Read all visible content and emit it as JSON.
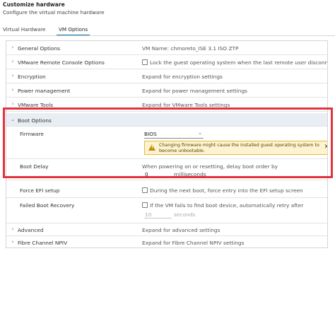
{
  "header": {
    "title": "Customize hardware",
    "subtitle": "Configure the virtual machine hardware"
  },
  "tabs": [
    {
      "label": "Virtual Hardware",
      "active": false
    },
    {
      "label": "VM Options",
      "active": true
    }
  ],
  "rows": {
    "general": {
      "label": "General Options",
      "value": "VM Name: chmoreto_ISE 3.1 ISO ZTP"
    },
    "vmrc": {
      "label": "VMware Remote Console Options",
      "value": "Lock the guest operating system when the last remote user disconnects"
    },
    "encryption": {
      "label": "Encryption",
      "value": "Expand for encryption settings"
    },
    "power": {
      "label": "Power management",
      "value": "Expand for power management settings"
    },
    "tools": {
      "label": "VMware Tools",
      "value": "Expand for VMware Tools settings"
    },
    "boot": {
      "label": "Boot Options"
    },
    "firmware": {
      "label": "Firmware",
      "selected": "BIOS",
      "warning": "Changing firmware might cause the installed guest operating system to become unbootable."
    },
    "boot_delay": {
      "label": "Boot Delay",
      "description": "When powering on or resetting, delay boot order by",
      "value": "0",
      "unit": "milliseconds"
    },
    "efi": {
      "label": "Force EFI setup",
      "value": "During the next boot, force entry into the EFI setup screen"
    },
    "recovery": {
      "label": "Failed Boot Recovery",
      "value": "If the VM fails to find boot device, automatically retry after",
      "seconds_value": "10",
      "unit": "seconds"
    },
    "advanced": {
      "label": "Advanced",
      "value": "Expand for advanced settings"
    },
    "npiv": {
      "label": "Fibre Channel NPIV",
      "value": "Expand for Fibre Channel NPIV settings"
    }
  },
  "colors": {
    "accent": "#0072a3",
    "highlight_border": "#e3333f",
    "warning_bg": "#fdf3d1",
    "warning_border": "#e8b934"
  }
}
